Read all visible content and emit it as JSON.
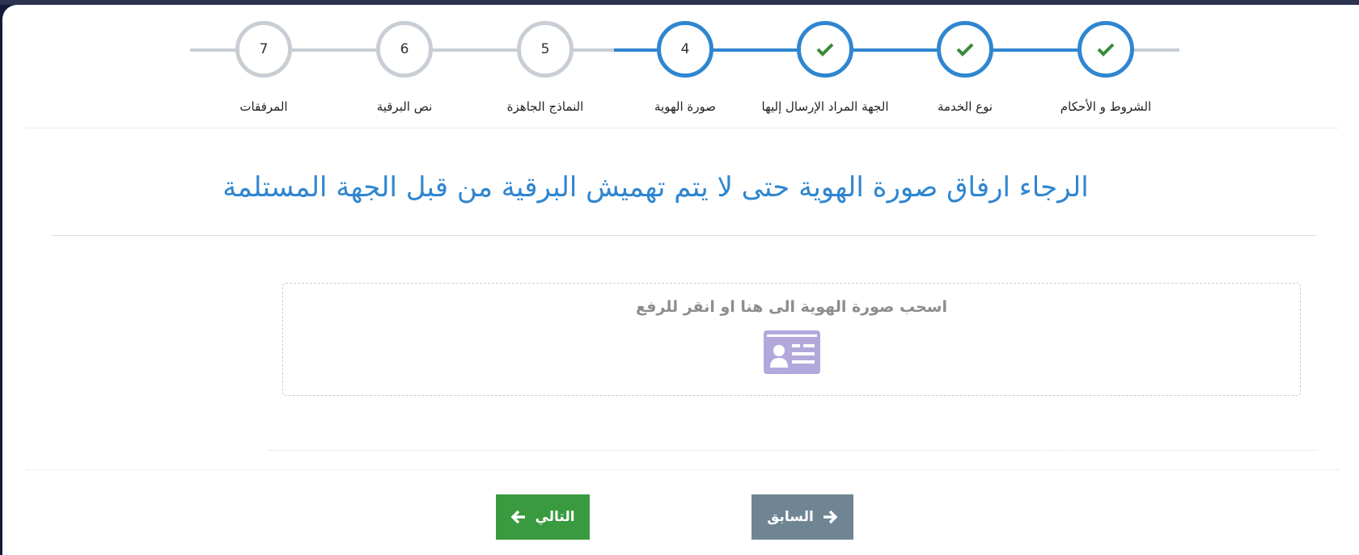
{
  "stepper": {
    "steps": [
      {
        "label": "الشروط و الأحكام",
        "state": "done",
        "number": ""
      },
      {
        "label": "نوع الخدمة",
        "state": "done",
        "number": ""
      },
      {
        "label": "الجهة المراد الإرسال إليها",
        "state": "done",
        "number": ""
      },
      {
        "label": "صورة الهوية",
        "state": "active",
        "number": "4"
      },
      {
        "label": "النماذج الجاهزة",
        "state": "pending",
        "number": "5"
      },
      {
        "label": "نص البرقية",
        "state": "pending",
        "number": "6"
      },
      {
        "label": "المرفقات",
        "state": "pending",
        "number": "7"
      }
    ],
    "done_icon": "check-icon"
  },
  "main": {
    "heading": "الرجاء ارفاق صورة الهوية حتى لا يتم تهميش البرقية من قبل الجهة المستلمة"
  },
  "dropzone": {
    "text": "اسحب صورة الهوية الى هنا او انقر للرفع",
    "icon": "id-card-icon"
  },
  "buttons": {
    "next_label": "التالي",
    "prev_label": "السابق"
  },
  "colors": {
    "primary": "#2f86d0",
    "check": "#3a8a3a",
    "pending": "#c8ced4",
    "next_button": "#3a9a3f",
    "prev_button": "#6f8594",
    "id_icon": "#b3a8dc"
  }
}
